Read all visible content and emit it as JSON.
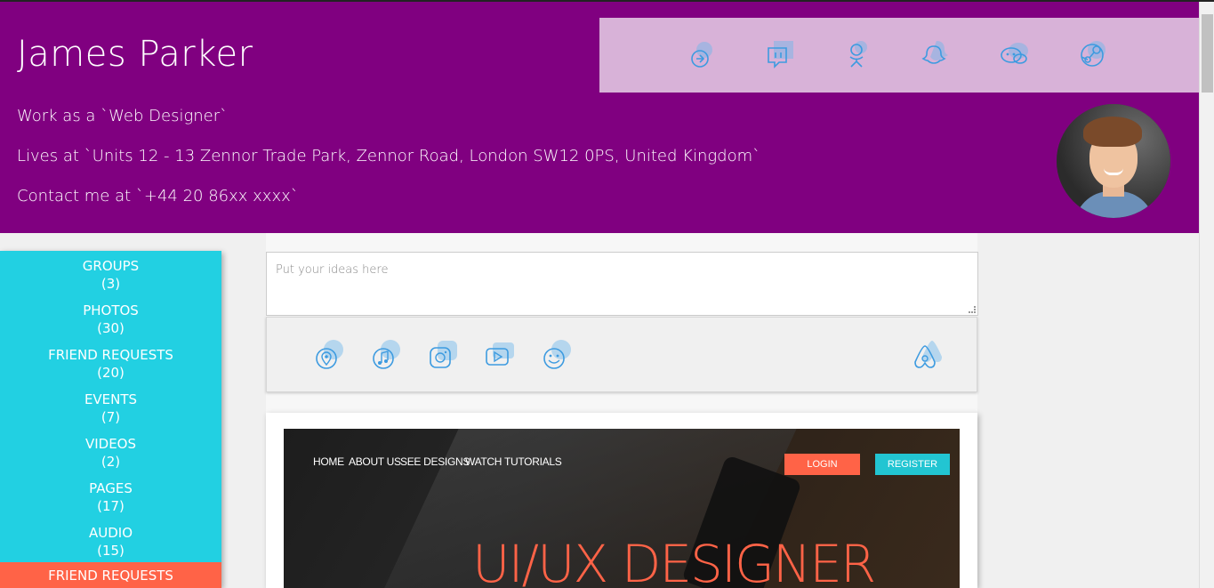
{
  "profile": {
    "name": "James Parker",
    "work": "Work as a `Web Designer`",
    "lives": "Lives at `Units 12 - 13 Zennor Trade Park, Zennor Road, London SW12 0PS, United Kingdom`",
    "contact": "Contact me at `+44 20 86xx xxxx`"
  },
  "social_icons": [
    "blogger-icon",
    "twitch-icon",
    "odnoklassniki-icon",
    "snapchat-icon",
    "wechat-icon",
    "steam-icon"
  ],
  "sidebar": {
    "items": [
      {
        "label": "GROUPS",
        "count": "(3)"
      },
      {
        "label": "PHOTOS",
        "count": "(30)"
      },
      {
        "label": "FRIEND REQUESTS",
        "count": "(20)"
      },
      {
        "label": "EVENTS",
        "count": "(7)"
      },
      {
        "label": "VIDEOS",
        "count": "(2)"
      },
      {
        "label": "PAGES",
        "count": "(17)"
      },
      {
        "label": "AUDIO",
        "count": "(15)"
      }
    ],
    "active_label": "FRIEND REQUESTS"
  },
  "composer": {
    "placeholder": "Put your ideas here",
    "tools": [
      "location-icon",
      "music-icon",
      "instagram-icon",
      "video-icon",
      "emoji-icon"
    ],
    "right_tool": "airbnb-icon"
  },
  "post": {
    "nav": [
      "HOME",
      "ABOUT US",
      "SEE DESIGNS",
      "WATCH TUTORIALS"
    ],
    "login": "LOGIN",
    "register": "REGISTER",
    "hero_title": "UI/UX DESIGNER"
  },
  "colors": {
    "header": "#800080",
    "social_bar": "#d8b2d8",
    "sidebar": "#22d0e2",
    "active": "#ff6347",
    "icon": "#3d9be0"
  }
}
